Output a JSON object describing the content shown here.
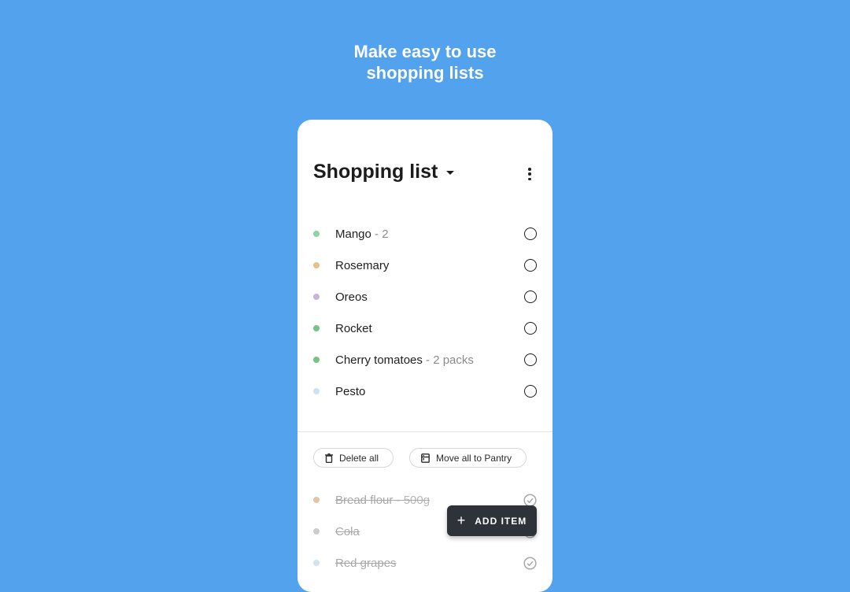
{
  "headline": {
    "line1": "Make easy to use",
    "line2": "shopping lists"
  },
  "header": {
    "title": "Shopping list"
  },
  "items": [
    {
      "name": "Mango",
      "qty": " - 2",
      "color": "#8fd3a0"
    },
    {
      "name": "Rosemary",
      "qty": "",
      "color": "#e8c088"
    },
    {
      "name": "Oreos",
      "qty": "",
      "color": "#c9b2de"
    },
    {
      "name": "Rocket",
      "qty": "",
      "color": "#76c482"
    },
    {
      "name": "Cherry tomatoes",
      "qty": " - 2 packs",
      "color": "#76c482"
    },
    {
      "name": "Pesto",
      "qty": "",
      "color": "#cfe0ef"
    }
  ],
  "actions": {
    "delete_all": "Delete all",
    "move_all": "Move all to Pantry"
  },
  "completed": [
    {
      "name": "Bread flour",
      "qty": " - 500g",
      "color": "#e2c3a8"
    },
    {
      "name": "Cola",
      "qty": "",
      "color": "#cccccc"
    },
    {
      "name": "Red grapes",
      "qty": "",
      "color": "#d2e2f0"
    }
  ],
  "fab": {
    "label": "ADD ITEM"
  },
  "colors": {
    "background": "#52a2ee",
    "fab": "#2d3338"
  }
}
